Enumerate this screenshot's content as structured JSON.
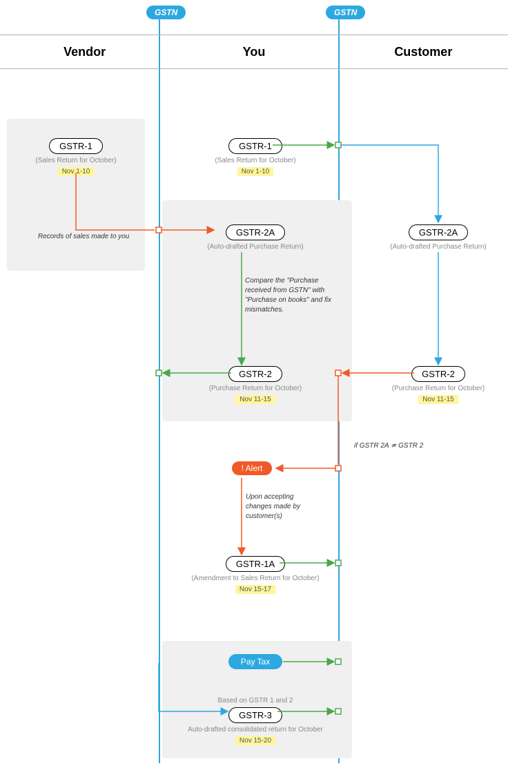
{
  "gstn_label": "GSTN",
  "lanes": {
    "vendor": "Vendor",
    "you": "You",
    "customer": "Customer"
  },
  "vendor_gstr1": {
    "title": "GSTR-1",
    "sub": "(Sales Return for October)",
    "date": "Nov 1-10"
  },
  "vendor_note": "Records of sales made to you",
  "you_gstr1": {
    "title": "GSTR-1",
    "sub": "(Sales Return for October)",
    "date": "Nov 1-10"
  },
  "you_gstr2a": {
    "title": "GSTR-2A",
    "sub": "(Auto-drafted Purchase Return)"
  },
  "compare_note": "Compare the \"Purchase received from GSTN\" with \"Purchase on books\" and fix mismatches.",
  "you_gstr2": {
    "title": "GSTR-2",
    "sub": "(Purchase Return for October)",
    "date": "Nov 11-15"
  },
  "cust_gstr2a": {
    "title": "GSTR-2A",
    "sub": "(Auto-drafted Purchase Return)"
  },
  "cust_gstr2": {
    "title": "GSTR-2",
    "sub": "(Purchase Return for October)",
    "date": "Nov 11-15"
  },
  "mismatch_note": "if GSTR 2A  ≄  GSTR 2",
  "alert_label": "! Alert",
  "accept_note": "Upon accepting changes made by customer(s)",
  "you_gstr1a": {
    "title": "GSTR-1A",
    "sub": "(Amendment to Sales Return for October)",
    "date": "Nov 15-17"
  },
  "paytax_label": "Pay Tax",
  "gstr3_pre": "Based on GSTR 1 and 2",
  "you_gstr3": {
    "title": "GSTR-3",
    "sub": "Auto-drafted consolidated return for October",
    "date": "Nov 15-20"
  }
}
